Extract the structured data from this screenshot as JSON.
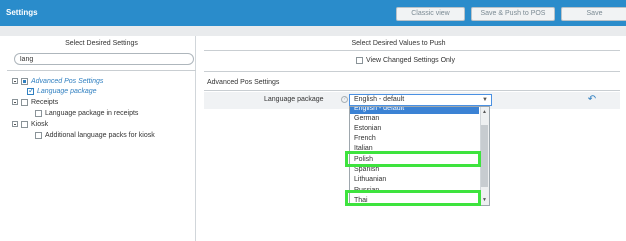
{
  "header": {
    "title": "Settings",
    "buttons": {
      "classic_view": "Classic view",
      "save_push": "Save & Push to POS",
      "save": "Save"
    }
  },
  "left": {
    "heading": "Select Desired Settings",
    "search_value": "lang",
    "tree": [
      {
        "label": "Advanced Pos Settings",
        "child": "Language package"
      },
      {
        "label": "Receipts",
        "child": "Language package in receipts"
      },
      {
        "label": "Kiosk",
        "child": "Additional language packs for kiosk"
      }
    ]
  },
  "right": {
    "heading": "Select Desired Values to Push",
    "view_changed_label": "View Changed Settings Only",
    "section_title": "Advanced Pos Settings",
    "setting_label": "Language package",
    "help_glyph": "?",
    "select_value": "English - default"
  },
  "dropdown": {
    "options": [
      "English - default",
      "German",
      "Estonian",
      "French",
      "Italian",
      "Polish",
      "Spanish",
      "Lithuanian",
      "Russian",
      "Thai"
    ],
    "highlighted": [
      "Polish",
      "Thai"
    ]
  },
  "colors": {
    "header": "#2a8ccb",
    "accent": "#2f7fc0",
    "highlight_box": "#3ee33e"
  }
}
